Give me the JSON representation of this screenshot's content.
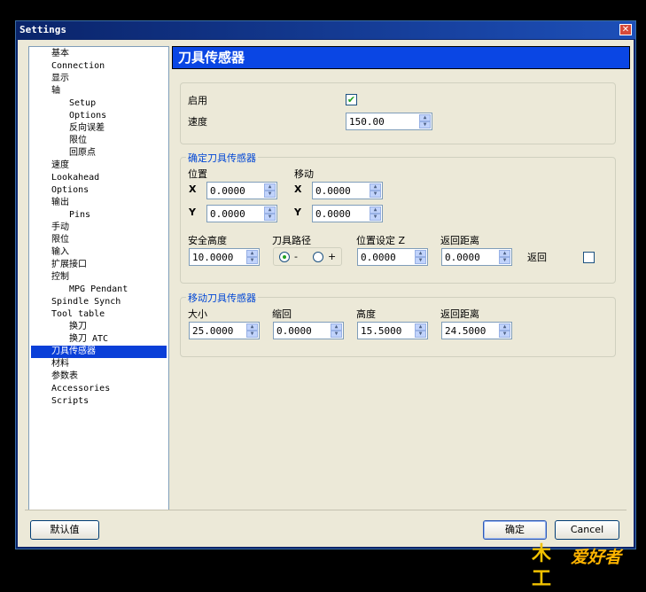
{
  "window": {
    "title": "Settings",
    "close_glyph": "✕"
  },
  "tree": {
    "items": [
      {
        "label": "基本",
        "indent": 0
      },
      {
        "label": "Connection",
        "indent": 0
      },
      {
        "label": "显示",
        "indent": 0
      },
      {
        "label": "轴",
        "indent": 0
      },
      {
        "label": "Setup",
        "indent": 1
      },
      {
        "label": "Options",
        "indent": 1
      },
      {
        "label": "反向误差",
        "indent": 1
      },
      {
        "label": "限位",
        "indent": 1
      },
      {
        "label": "回原点",
        "indent": 1
      },
      {
        "label": "速度",
        "indent": 0
      },
      {
        "label": "Lookahead",
        "indent": 0
      },
      {
        "label": "Options",
        "indent": 0
      },
      {
        "label": "输出",
        "indent": 0
      },
      {
        "label": "Pins",
        "indent": 1
      },
      {
        "label": "手动",
        "indent": 0
      },
      {
        "label": "限位",
        "indent": 0
      },
      {
        "label": "输入",
        "indent": 0
      },
      {
        "label": "扩展接口",
        "indent": 0
      },
      {
        "label": "控制",
        "indent": 0
      },
      {
        "label": "MPG Pendant",
        "indent": 1
      },
      {
        "label": "Spindle Synch",
        "indent": 0
      },
      {
        "label": "Tool table",
        "indent": 0
      },
      {
        "label": "换刀",
        "indent": 1
      },
      {
        "label": "换刀 ATC",
        "indent": 1
      },
      {
        "label": "刀具传感器",
        "indent": 0,
        "selected": true
      },
      {
        "label": "材料",
        "indent": 0
      },
      {
        "label": "参数表",
        "indent": 0
      },
      {
        "label": "Accessories",
        "indent": 0
      },
      {
        "label": "Scripts",
        "indent": 0
      }
    ]
  },
  "panel": {
    "title": "刀具传感器",
    "enable_group": {
      "enable_label": "启用",
      "enable_checked": true,
      "check_glyph": "✔",
      "speed_label": "速度",
      "speed_value": "150.00"
    },
    "determine_group": {
      "title": "确定刀具传感器",
      "position_label": "位置",
      "move_label": "移动",
      "x_label": "X",
      "y_label": "Y",
      "pos_x": "0.0000",
      "pos_y": "0.0000",
      "move_x": "0.0000",
      "move_y": "0.0000",
      "safe_height_label": "安全高度",
      "safe_height_value": "10.0000",
      "tool_path_label": "刀具路径",
      "minus_label": "-",
      "plus_label": "+",
      "tool_path_selected": "-",
      "pos_set_z_label": "位置设定 Z",
      "pos_set_z_value": "0.0000",
      "return_dist_label": "返回距离",
      "return_dist_value": "0.0000",
      "return_label": "返回",
      "return_checked": false
    },
    "move_group": {
      "title": "移动刀具传感器",
      "size_label": "大小",
      "size_value": "25.0000",
      "retract_label": "缩回",
      "retract_value": "0.0000",
      "height_label": "高度",
      "height_value": "15.5000",
      "return_dist_label": "返回距离",
      "return_dist_value": "24.5000"
    }
  },
  "buttons": {
    "defaults": "默认值",
    "ok": "确定",
    "cancel": "Cancel"
  },
  "watermark": {
    "logo_text": "木工",
    "text": "爱好者"
  },
  "colors": {
    "header_blue": "#0a46e4",
    "selection_blue": "#0a3fd8",
    "group_title": "#0046d5",
    "check_green": "#21a121"
  }
}
